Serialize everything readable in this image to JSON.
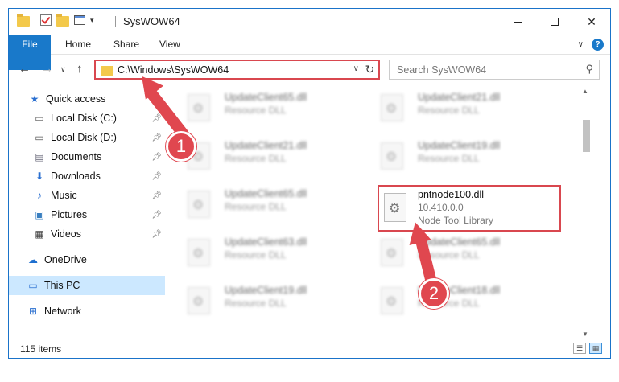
{
  "window": {
    "title": "SysWOW64"
  },
  "ribbon": {
    "tabs": [
      "File",
      "Home",
      "Share",
      "View"
    ]
  },
  "address": {
    "path": "C:\\Windows\\SysWOW64"
  },
  "search": {
    "placeholder": "Search SysWOW64"
  },
  "sidebar": {
    "items": [
      {
        "label": "Quick access",
        "icon": "star-icon",
        "pinned": false
      },
      {
        "label": "Local Disk (C:)",
        "icon": "drive-icon",
        "pinned": true
      },
      {
        "label": "Local Disk (D:)",
        "icon": "drive-icon",
        "pinned": true
      },
      {
        "label": "Documents",
        "icon": "document-icon",
        "pinned": true
      },
      {
        "label": "Downloads",
        "icon": "download-icon",
        "pinned": true
      },
      {
        "label": "Music",
        "icon": "music-icon",
        "pinned": true
      },
      {
        "label": "Pictures",
        "icon": "pictures-icon",
        "pinned": true
      },
      {
        "label": "Videos",
        "icon": "video-icon",
        "pinned": true
      },
      {
        "label": "OneDrive",
        "icon": "cloud-icon",
        "pinned": false
      },
      {
        "label": "This PC",
        "icon": "computer-icon",
        "pinned": false,
        "selected": true
      },
      {
        "label": "Network",
        "icon": "network-icon",
        "pinned": false
      }
    ]
  },
  "files": {
    "left": [
      {
        "name": "UpdateClient65.dll",
        "desc": "Resource DLL"
      },
      {
        "name": "UpdateClient21.dll",
        "desc": "Resource DLL"
      },
      {
        "name": "UpdateClient65.dll",
        "desc": "Resource DLL"
      },
      {
        "name": "UpdateClient63.dll",
        "desc": "Resource DLL"
      },
      {
        "name": "UpdateClient19.dll",
        "desc": "Resource DLL"
      }
    ],
    "right": [
      {
        "name": "UpdateClient21.dll",
        "desc": "Resource DLL"
      },
      {
        "name": "UpdateClient19.dll",
        "desc": "Resource DLL"
      },
      {
        "name": "UpdateClient65.dll",
        "desc": "Resource DLL"
      },
      {
        "name": "UpdateClient18.dll",
        "desc": "Resource DLL"
      }
    ],
    "highlighted": {
      "name": "pntnode100.dll",
      "version": "10.410.0.0",
      "desc": "Node Tool Library"
    }
  },
  "status": {
    "count": "115 items"
  },
  "callouts": {
    "one": "1",
    "two": "2"
  },
  "colors": {
    "accent": "#1979ca",
    "highlight": "#d9474f",
    "selected": "#cce8ff"
  }
}
